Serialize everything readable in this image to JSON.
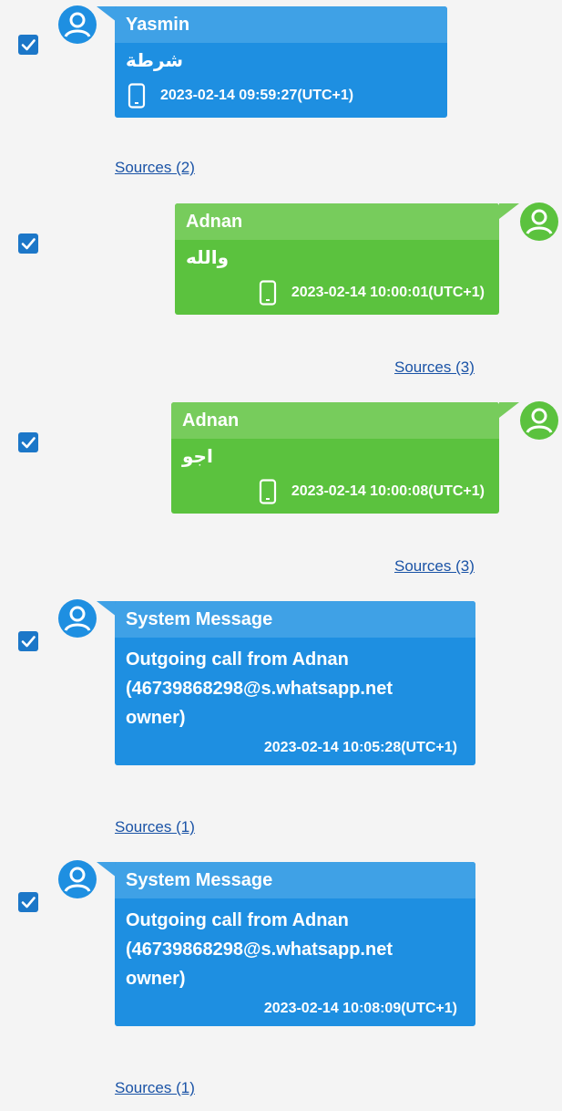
{
  "messages": [
    {
      "sender": "Yasmin",
      "text": "شرطة",
      "timestamp": "2023-02-14 09:59:27(UTC+1)",
      "sources": "Sources (2)",
      "direction": "incoming",
      "checked": true,
      "icon": "phone-icon"
    },
    {
      "sender": "Adnan",
      "text": "والله",
      "timestamp": "2023-02-14 10:00:01(UTC+1)",
      "sources": "Sources (3)",
      "direction": "outgoing",
      "checked": true,
      "icon": "phone-icon"
    },
    {
      "sender": "Adnan",
      "text": "اجو",
      "timestamp": "2023-02-14 10:00:08(UTC+1)",
      "sources": "Sources (3)",
      "direction": "outgoing",
      "checked": true,
      "icon": "phone-icon"
    },
    {
      "sender": "System Message",
      "lines": [
        "Outgoing call from Adnan",
        "(46739868298@s.whatsapp.net",
        "owner)"
      ],
      "timestamp": "2023-02-14 10:05:28(UTC+1)",
      "sources": "Sources (1)",
      "direction": "system",
      "checked": true
    },
    {
      "sender": "System Message",
      "lines": [
        "Outgoing call from Adnan",
        "(46739868298@s.whatsapp.net",
        "owner)"
      ],
      "timestamp": "2023-02-14 10:08:09(UTC+1)",
      "sources": "Sources (1)",
      "direction": "system",
      "checked": true
    }
  ],
  "colors": {
    "incoming_body": "#1e8fe1",
    "incoming_header": "#3fa1e6",
    "outgoing_body": "#5bc23e",
    "outgoing_header": "#77cc5c",
    "checkbox": "#1c77c8",
    "link": "#1a53a6"
  }
}
